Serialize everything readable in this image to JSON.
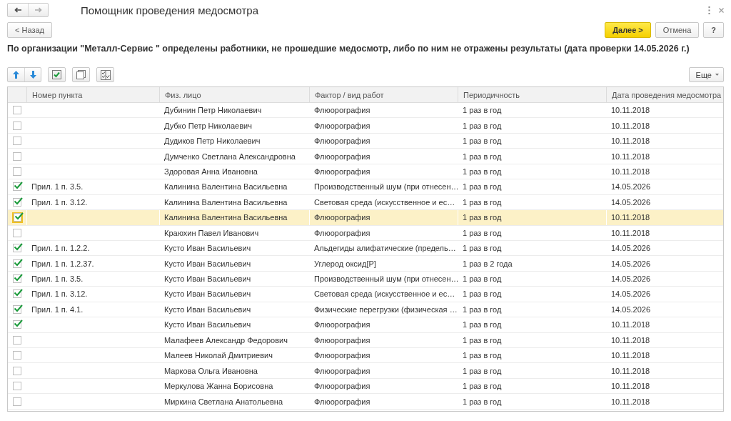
{
  "window": {
    "title": "Помощник проведения медосмотра"
  },
  "buttons": {
    "back": "< Назад",
    "next": "Далее >",
    "cancel": "Отмена",
    "help": "?"
  },
  "heading": "По организации \"Металл-Сервис \" определены работники, не прошедшие медосмотр, либо по ним не отражены результаты (дата проверки 14.05.2026 г.)",
  "toolbar": {
    "more": "Еще"
  },
  "table": {
    "columns": [
      "Номер пункта",
      "Физ. лицо",
      "Фактор / вид работ",
      "Периодичность",
      "Дата проведения медосмотра"
    ],
    "rows": [
      {
        "checked": false,
        "selected": false,
        "cells": [
          "",
          "Дубинин Петр Николаевич",
          "Флюорография",
          "1 раз в год",
          "10.11.2018"
        ]
      },
      {
        "checked": false,
        "selected": false,
        "cells": [
          "",
          "Дубко Петр Николаевич",
          "Флюорография",
          "1 раз в год",
          "10.11.2018"
        ]
      },
      {
        "checked": false,
        "selected": false,
        "cells": [
          "",
          "Дудиков Петр Николаевич",
          "Флюорография",
          "1 раз в год",
          "10.11.2018"
        ]
      },
      {
        "checked": false,
        "selected": false,
        "cells": [
          "",
          "Думченко Светлана Александровна",
          "Флюорография",
          "1 раз в год",
          "10.11.2018"
        ]
      },
      {
        "checked": false,
        "selected": false,
        "cells": [
          "",
          "Здоровая Анна Ивановна",
          "Флюорография",
          "1 раз в год",
          "10.11.2018"
        ]
      },
      {
        "checked": true,
        "selected": false,
        "cells": [
          "Прил. 1 п. 3.5.",
          "Калинина Валентина Васильевна",
          "Производственный шум (при отнесен…",
          "1 раз в год",
          "14.05.2026"
        ]
      },
      {
        "checked": true,
        "selected": false,
        "cells": [
          "Прил. 1 п. 3.12.",
          "Калинина Валентина Васильевна",
          "Световая среда (искусственное и ес…",
          "1 раз в год",
          "14.05.2026"
        ]
      },
      {
        "checked": true,
        "selected": true,
        "cells": [
          "",
          "Калинина Валентина Васильевна",
          "Флюорография",
          "1 раз в год",
          "10.11.2018"
        ]
      },
      {
        "checked": false,
        "selected": false,
        "cells": [
          "",
          "Краюхин Павел Иванович",
          "Флюорография",
          "1 раз в год",
          "10.11.2018"
        ]
      },
      {
        "checked": true,
        "selected": false,
        "cells": [
          "Прил. 1 п. 1.2.2.",
          "Кусто Иван Васильевич",
          "Альдегиды алифатические (предель…",
          "1 раз в год",
          "14.05.2026"
        ]
      },
      {
        "checked": true,
        "selected": false,
        "cells": [
          "Прил. 1 п. 1.2.37.",
          "Кусто Иван Васильевич",
          "Углерод оксид[Р]",
          "1 раз в 2 года",
          "14.05.2026"
        ]
      },
      {
        "checked": true,
        "selected": false,
        "cells": [
          "Прил. 1 п. 3.5.",
          "Кусто Иван Васильевич",
          "Производственный шум (при отнесен…",
          "1 раз в год",
          "14.05.2026"
        ]
      },
      {
        "checked": true,
        "selected": false,
        "cells": [
          "Прил. 1 п. 3.12.",
          "Кусто Иван Васильевич",
          "Световая среда (искусственное и ес…",
          "1 раз в год",
          "14.05.2026"
        ]
      },
      {
        "checked": true,
        "selected": false,
        "cells": [
          "Прил. 1 п. 4.1.",
          "Кусто Иван Васильевич",
          "Физические перегрузки (физическая …",
          "1 раз в год",
          "14.05.2026"
        ]
      },
      {
        "checked": true,
        "selected": false,
        "cells": [
          "",
          "Кусто Иван Васильевич",
          "Флюорография",
          "1 раз в год",
          "10.11.2018"
        ]
      },
      {
        "checked": false,
        "selected": false,
        "cells": [
          "",
          "Малафеев Александр Федорович",
          "Флюорография",
          "1 раз в год",
          "10.11.2018"
        ]
      },
      {
        "checked": false,
        "selected": false,
        "cells": [
          "",
          "Малеев Николай Дмитриевич",
          "Флюорография",
          "1 раз в год",
          "10.11.2018"
        ]
      },
      {
        "checked": false,
        "selected": false,
        "cells": [
          "",
          "Маркова Ольга Ивановна",
          "Флюорография",
          "1 раз в год",
          "10.11.2018"
        ]
      },
      {
        "checked": false,
        "selected": false,
        "cells": [
          "",
          "Меркулова Жанна Борисовна",
          "Флюорография",
          "1 раз в год",
          "10.11.2018"
        ]
      },
      {
        "checked": false,
        "selected": false,
        "cells": [
          "",
          "Миркина Светлана Анатольевна",
          "Флюорография",
          "1 раз в год",
          "10.11.2018"
        ]
      }
    ]
  }
}
